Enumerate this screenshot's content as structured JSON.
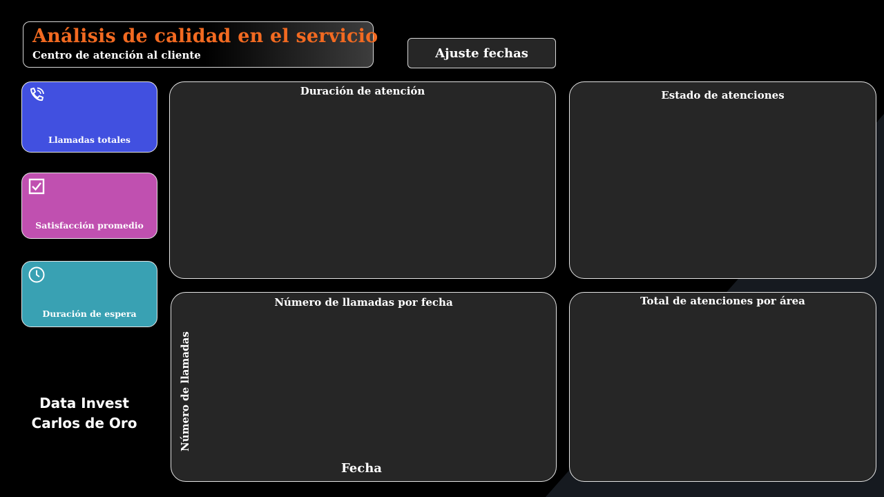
{
  "header": {
    "title": "Análisis de calidad en el servicio",
    "subtitle": "Centro de atención al cliente"
  },
  "date_button": {
    "label": "Ajuste fechas"
  },
  "kpis": {
    "calls": {
      "label": "Llamadas totales",
      "icon": "phone-icon",
      "color": "#4150e0"
    },
    "satisfaction": {
      "label": "Satisfacción promedio",
      "icon": "checkbox-icon",
      "color": "#c050b0"
    },
    "wait": {
      "label": "Duración de espera",
      "icon": "clock-icon",
      "color": "#39a1b3"
    }
  },
  "credits": {
    "line1": "Data Invest",
    "line2": "Carlos de Oro"
  },
  "panels": {
    "duration": {
      "title": "Duración de atención"
    },
    "status": {
      "title": "Estado de atenciones"
    },
    "calls_by_date": {
      "title": "Número de llamadas por fecha",
      "ylabel": "Número de llamadas",
      "xlabel": "Fecha"
    },
    "by_area": {
      "title": "Total de atenciones por área"
    }
  },
  "colors": {
    "accent": "#f26a21",
    "panel_bg": "#262626",
    "page_bg": "#000000"
  }
}
